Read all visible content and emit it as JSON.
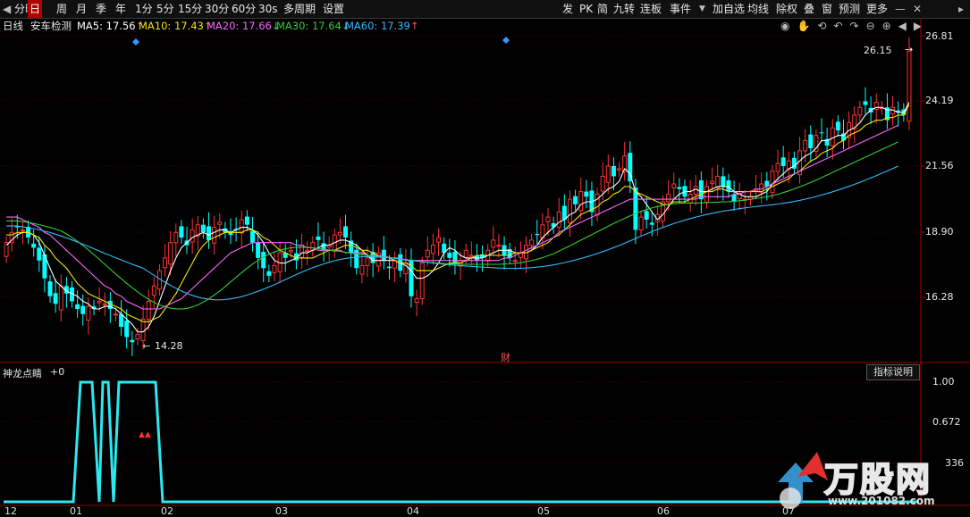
{
  "toolbar": {
    "left": [
      "分时",
      "日",
      "周",
      "月",
      "季",
      "年",
      "1分",
      "5分",
      "15分",
      "30分",
      "60分",
      "30s",
      "多周期",
      "设置"
    ],
    "selected_index": 1,
    "right": [
      "发",
      "PK",
      "简",
      "九转",
      "连板",
      "事件",
      "加自选",
      "均线",
      "除权",
      "叠",
      "窗",
      "预测",
      "更多"
    ]
  },
  "info": {
    "period": "日线",
    "stock": "安车检测",
    "ma": [
      {
        "label": "MA5: 17.56",
        "arrow": "↑",
        "color": "#ffffff"
      },
      {
        "label": "MA10: 17.43",
        "arrow": "↑",
        "color": "#f5e600"
      },
      {
        "label": "MA20: 17.66",
        "arrow": "↓",
        "color": "#ff66ff"
      },
      {
        "label": "MA30: 17.64",
        "arrow": "↓",
        "color": "#33cc33"
      },
      {
        "label": "MA60: 17.39",
        "arrow": "↑",
        "color": "#33bbff"
      }
    ]
  },
  "price_axis": [
    "26.81",
    "24.19",
    "21.56",
    "18.90",
    "16.28"
  ],
  "annotations": {
    "high": "26.15",
    "low": "14.28",
    "event": "财"
  },
  "indicator": {
    "name": "神龙点睛",
    "value": "+0",
    "button": "指标说明",
    "axis": [
      "1.00",
      "0.672",
      "336"
    ]
  },
  "x_labels": [
    "12",
    "01",
    "02",
    "03",
    "04",
    "05",
    "06",
    "07"
  ],
  "watermark": {
    "brand": "万股网",
    "url": "www.201082.com"
  },
  "colors": {
    "up": "#ff3232",
    "down": "#00ffff",
    "indicator": "#2be8f0"
  },
  "chart_data": {
    "type": "candlestick",
    "ylim": [
      13.9,
      27.2
    ],
    "closes": [
      18.6,
      19.0,
      19.2,
      19.1,
      18.8,
      18.4,
      17.9,
      17.2,
      16.5,
      16.2,
      16.9,
      16.6,
      16.3,
      16.0,
      15.8,
      16.1,
      16.0,
      16.3,
      16.2,
      16.0,
      15.8,
      15.3,
      14.9,
      14.7,
      15.0,
      15.6,
      16.3,
      16.9,
      17.5,
      18.0,
      18.6,
      19.0,
      18.8,
      18.5,
      19.1,
      19.3,
      19.0,
      18.7,
      19.2,
      19.4,
      19.0,
      18.9,
      19.1,
      19.5,
      19.3,
      18.6,
      18.0,
      17.6,
      17.3,
      17.7,
      18.2,
      18.0,
      18.3,
      17.9,
      18.5,
      18.3,
      18.6,
      18.7,
      18.3,
      18.5,
      18.9,
      19.0,
      18.8,
      18.2,
      17.6,
      17.7,
      18.0,
      17.8,
      18.2,
      17.9,
      17.6,
      17.9,
      17.5,
      17.8,
      16.5,
      16.4,
      17.8,
      18.3,
      18.5,
      18.8,
      18.2,
      18.0,
      17.8,
      17.9,
      18.3,
      18.1,
      17.9,
      18.0,
      18.3,
      18.7,
      18.5,
      18.1,
      18.0,
      17.9,
      18.2,
      18.5,
      18.7,
      18.9,
      19.3,
      19.6,
      19.2,
      19.8,
      19.5,
      20.3,
      20.1,
      20.6,
      20.4,
      19.8,
      20.5,
      21.2,
      21.6,
      21.2,
      21.5,
      22.0,
      21.0,
      19.1,
      19.6,
      19.5,
      19.3,
      19.7,
      20.2,
      20.5,
      20.9,
      20.7,
      20.4,
      20.5,
      20.8,
      20.3,
      20.8,
      21.0,
      21.2,
      20.8,
      20.6,
      20.2,
      20.5,
      20.3,
      20.4,
      20.7,
      20.9,
      20.8,
      21.4,
      21.7,
      21.6,
      21.8,
      21.5,
      22.2,
      22.6,
      22.3,
      22.8,
      22.9,
      22.4,
      23.1,
      23.0,
      22.6,
      23.3,
      23.6,
      23.9,
      24.0,
      23.7,
      24.1,
      23.9,
      23.4,
      23.9,
      23.7,
      23.6,
      26.1
    ],
    "ma5": [
      18.5,
      18.7,
      18.9,
      19.0,
      19.0,
      18.9,
      18.6,
      18.1,
      17.6,
      17.1,
      16.9,
      16.7,
      16.6,
      16.5,
      16.3,
      16.2,
      16.0,
      16.0,
      16.1,
      16.1,
      16.0,
      15.8,
      15.6,
      15.4,
      15.1,
      15.1,
      15.3,
      15.7,
      16.3,
      16.9,
      17.5,
      18.0,
      18.4,
      18.6,
      18.8,
      18.9,
      19.0,
      18.9,
      19.0,
      19.1,
      19.1,
      19.0,
      19.1,
      19.2,
      19.2,
      19.1,
      18.9,
      18.6,
      18.2,
      17.9,
      17.8,
      17.8,
      17.9,
      18.0,
      18.2,
      18.2,
      18.3,
      18.4,
      18.5,
      18.5,
      18.6,
      18.7,
      18.7,
      18.6,
      18.5,
      18.3,
      18.1,
      17.9,
      17.9,
      17.9,
      17.9,
      17.9,
      17.8,
      17.7,
      17.5,
      17.2,
      17.2,
      17.3,
      17.5,
      17.8,
      18.2,
      18.4,
      18.3,
      18.1,
      18.0,
      18.0,
      18.0,
      18.0,
      18.1,
      18.2,
      18.3,
      18.3,
      18.3,
      18.2,
      18.2,
      18.2,
      18.3,
      18.5,
      18.8,
      19.0,
      19.2,
      19.4,
      19.5,
      19.7,
      19.8,
      20.1,
      20.2,
      20.2,
      20.3,
      20.5,
      20.7,
      20.8,
      21.0,
      21.5,
      21.3,
      20.6,
      20.4,
      20.1,
      19.8,
      19.5,
      19.7,
      20.0,
      20.3,
      20.5,
      20.6,
      20.6,
      20.7,
      20.6,
      20.6,
      20.7,
      20.8,
      20.8,
      20.8,
      20.6,
      20.5,
      20.4,
      20.4,
      20.4,
      20.5,
      20.6,
      20.9,
      21.1,
      21.3,
      21.5,
      21.6,
      21.8,
      22.0,
      22.1,
      22.3,
      22.6,
      22.6,
      22.7,
      22.8,
      22.8,
      23.0,
      23.1,
      23.3,
      23.6,
      23.8,
      23.9,
      23.9,
      23.8,
      23.8,
      23.7,
      23.7,
      24.1
    ],
    "ma10": [
      18.9,
      18.9,
      19.0,
      19.0,
      19.0,
      18.9,
      18.8,
      18.5,
      18.3,
      18.0,
      17.8,
      17.6,
      17.3,
      17.0,
      16.8,
      16.6,
      16.5,
      16.4,
      16.3,
      16.2,
      16.1,
      16.0,
      15.8,
      15.7,
      15.6,
      15.5,
      15.5,
      15.6,
      15.7,
      16.0,
      16.3,
      16.6,
      17.0,
      17.4,
      17.8,
      18.2,
      18.5,
      18.7,
      18.8,
      18.9,
      19.0,
      19.0,
      19.0,
      19.0,
      19.1,
      19.1,
      19.0,
      18.8,
      18.7,
      18.5,
      18.3,
      18.2,
      18.1,
      18.0,
      18.0,
      18.0,
      18.0,
      18.1,
      18.2,
      18.3,
      18.3,
      18.4,
      18.5,
      18.5,
      18.4,
      18.3,
      18.3,
      18.2,
      18.1,
      18.1,
      18.0,
      17.9,
      17.8,
      17.8,
      17.7,
      17.5,
      17.5,
      17.5,
      17.5,
      17.6,
      17.7,
      17.8,
      17.8,
      17.8,
      17.9,
      18.0,
      18.1,
      18.1,
      18.1,
      18.1,
      18.1,
      18.1,
      18.1,
      18.2,
      18.2,
      18.2,
      18.3,
      18.4,
      18.5,
      18.6,
      18.8,
      18.9,
      19.1,
      19.3,
      19.5,
      19.7,
      19.8,
      19.9,
      20.0,
      20.2,
      20.3,
      20.5,
      20.6,
      20.8,
      20.8,
      20.6,
      20.5,
      20.4,
      20.3,
      20.2,
      20.1,
      20.1,
      20.2,
      20.2,
      20.2,
      20.3,
      20.4,
      20.5,
      20.6,
      20.6,
      20.7,
      20.7,
      20.6,
      20.6,
      20.6,
      20.6,
      20.6,
      20.6,
      20.6,
      20.7,
      20.8,
      20.9,
      21.0,
      21.1,
      21.3,
      21.4,
      21.6,
      21.8,
      21.9,
      22.1,
      22.2,
      22.3,
      22.5,
      22.6,
      22.8,
      22.9,
      23.0,
      23.2,
      23.3,
      23.4,
      23.4,
      23.5,
      23.5,
      23.6,
      23.6,
      24.0
    ],
    "ma20": [
      19.6,
      19.6,
      19.6,
      19.5,
      19.4,
      19.3,
      19.2,
      19.0,
      18.9,
      18.7,
      18.5,
      18.3,
      18.1,
      17.9,
      17.7,
      17.5,
      17.3,
      17.1,
      16.9,
      16.8,
      16.6,
      16.5,
      16.3,
      16.2,
      16.1,
      16.0,
      16.0,
      16.0,
      16.0,
      16.1,
      16.2,
      16.3,
      16.4,
      16.6,
      16.8,
      17.0,
      17.2,
      17.4,
      17.6,
      17.8,
      18.0,
      18.2,
      18.3,
      18.4,
      18.5,
      18.6,
      18.6,
      18.6,
      18.6,
      18.6,
      18.6,
      18.6,
      18.6,
      18.5,
      18.5,
      18.4,
      18.4,
      18.3,
      18.3,
      18.3,
      18.3,
      18.3,
      18.2,
      18.2,
      18.2,
      18.2,
      18.1,
      18.1,
      18.1,
      18.1,
      18.0,
      18.0,
      18.0,
      17.9,
      17.9,
      17.9,
      17.9,
      17.9,
      17.9,
      17.9,
      17.9,
      17.9,
      17.9,
      17.9,
      17.9,
      17.9,
      17.9,
      17.9,
      17.9,
      17.9,
      17.9,
      18.0,
      18.0,
      18.1,
      18.2,
      18.3,
      18.4,
      18.5,
      18.6,
      18.7,
      18.8,
      19.0,
      19.1,
      19.2,
      19.3,
      19.4,
      19.5,
      19.6,
      19.7,
      19.8,
      19.9,
      20.0,
      20.1,
      20.2,
      20.3,
      20.3,
      20.3,
      20.3,
      20.3,
      20.3,
      20.3,
      20.3,
      20.3,
      20.3,
      20.3,
      20.3,
      20.3,
      20.4,
      20.4,
      20.4,
      20.4,
      20.4,
      20.4,
      20.5,
      20.5,
      20.6,
      20.6,
      20.7,
      20.7,
      20.8,
      20.9,
      21.0,
      21.1,
      21.2,
      21.3,
      21.4,
      21.5,
      21.6,
      21.7,
      21.8,
      21.9,
      22.0,
      22.1,
      22.2,
      22.3,
      22.4,
      22.5,
      22.6,
      22.7,
      22.8,
      22.9,
      23.0,
      23.1,
      23.2
    ]
  }
}
